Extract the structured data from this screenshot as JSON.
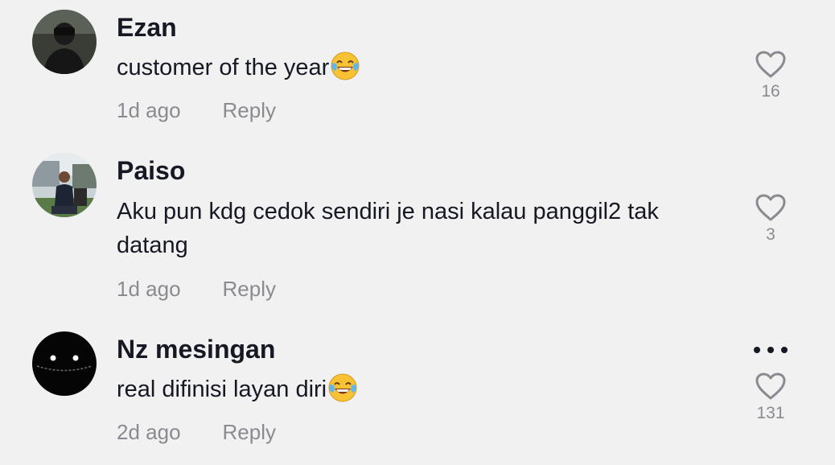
{
  "comments": [
    {
      "username": "Ezan",
      "text": "customer of the year",
      "emoji": "tears-of-joy-emoji",
      "time": "1d ago",
      "reply_label": "Reply",
      "likes": "16"
    },
    {
      "username": "Paiso",
      "text": "Aku pun kdg cedok sendiri je nasi kalau panggil2 tak datang",
      "time": "1d ago",
      "reply_label": "Reply",
      "likes": "3"
    },
    {
      "username": "Nz mesingan",
      "text": "real difinisi layan diri",
      "emoji": "tears-of-joy-emoji",
      "time": "2d ago",
      "reply_label": "Reply",
      "likes": "131",
      "more_icon": "more-horizontal-icon"
    }
  ],
  "icons": {
    "like": "heart-outline-icon"
  },
  "colors": {
    "background": "#f1f1f2",
    "username": "#161823",
    "secondary": "#8a8b91",
    "heart": "#8a8b91"
  }
}
